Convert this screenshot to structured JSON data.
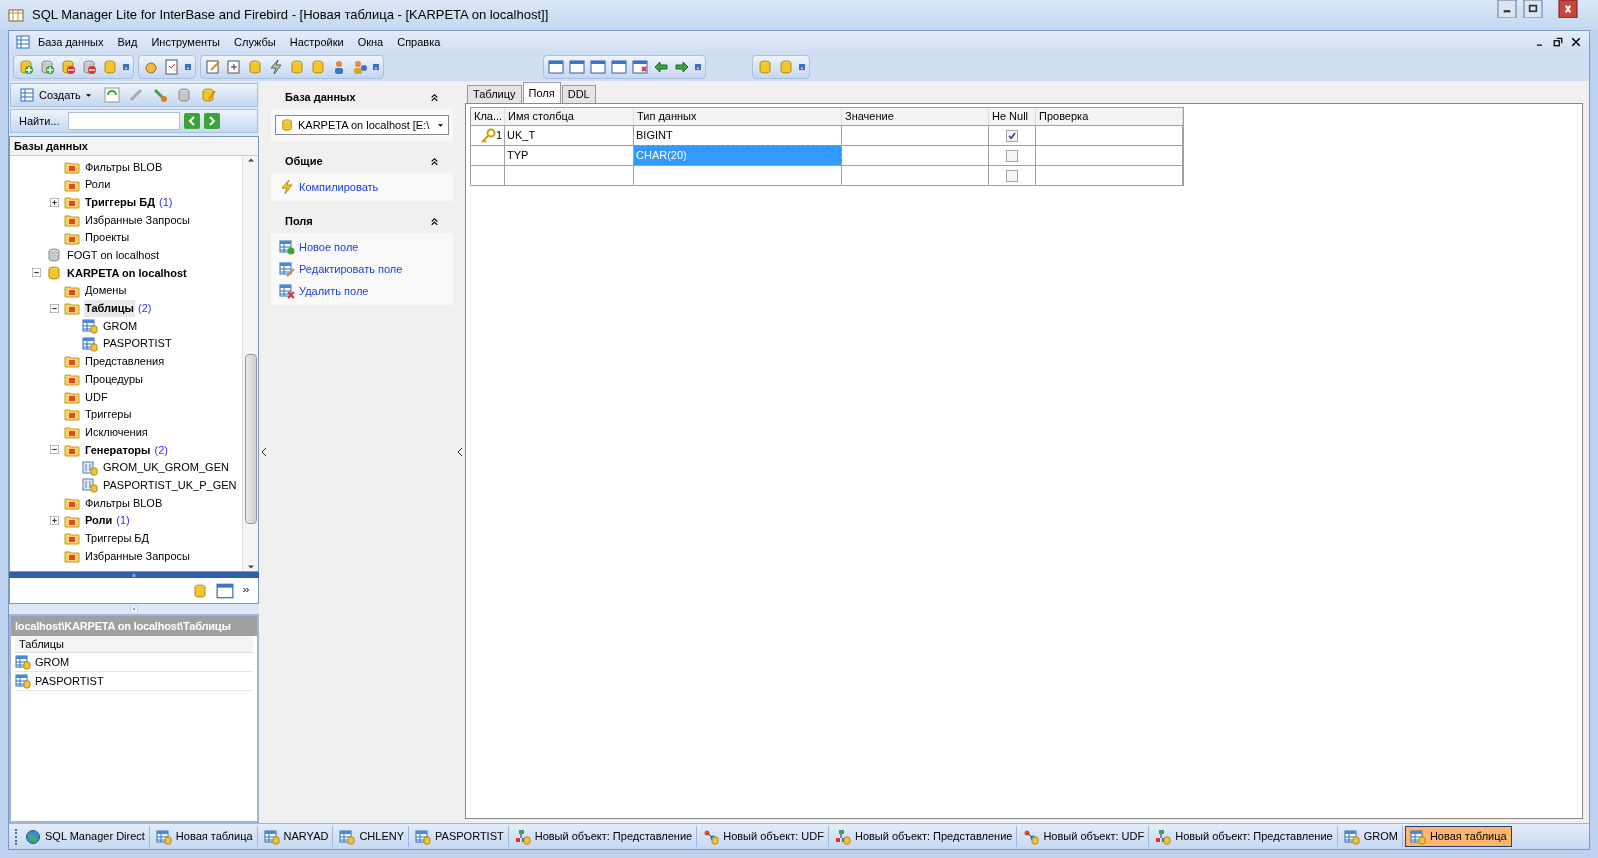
{
  "window": {
    "title": "SQL Manager Lite for InterBase and Firebird - [Новая таблица - [KARPETA on localhost]]"
  },
  "menu": [
    "База данных",
    "Вид",
    "Инструменты",
    "Службы",
    "Настройки",
    "Окна",
    "Справка"
  ],
  "explorer": {
    "create_button": "Создать",
    "search_label": "Найти...",
    "header": "Базы данных",
    "tree": {
      "continued_children": [
        {
          "label": "Фильтры BLOB",
          "kind": "folder",
          "selected": false
        },
        {
          "label": "Роли",
          "kind": "folder",
          "selected": false
        },
        {
          "label": "Триггеры БД",
          "count": "(1)",
          "kind": "folder",
          "expanded": false,
          "selected": false
        },
        {
          "label": "Избранные Запросы",
          "kind": "folder",
          "selected": false
        },
        {
          "label": "Проекты",
          "kind": "folder",
          "selected": false
        }
      ],
      "items": [
        {
          "label": "FOGT on localhost",
          "kind": "database",
          "connected": false,
          "selected": false
        },
        {
          "label": "KARPETA on localhost",
          "kind": "database",
          "connected": true,
          "expanded": true,
          "selected": false,
          "children": [
            {
              "label": "Домены",
              "kind": "folder",
              "selected": false
            },
            {
              "label": "Таблицы",
              "count": "(2)",
              "kind": "folder",
              "expanded": true,
              "selected": true,
              "children": [
                {
                  "label": "GROM",
                  "kind": "table",
                  "selected": false
                },
                {
                  "label": "PASPORTIST",
                  "kind": "table",
                  "selected": false
                }
              ]
            },
            {
              "label": "Представления",
              "kind": "folder",
              "selected": false
            },
            {
              "label": "Процедуры",
              "kind": "folder",
              "selected": false
            },
            {
              "label": "UDF",
              "kind": "folder",
              "selected": false
            },
            {
              "label": "Триггеры",
              "kind": "folder",
              "selected": false
            },
            {
              "label": "Исключения",
              "kind": "folder",
              "selected": false
            },
            {
              "label": "Генераторы",
              "count": "(2)",
              "kind": "folder",
              "expanded": true,
              "selected": false,
              "children": [
                {
                  "label": "GROM_UK_GROM_GEN",
                  "kind": "generator",
                  "selected": false
                },
                {
                  "label": "PASPORTIST_UK_P_GEN",
                  "kind": "generator",
                  "selected": false
                }
              ]
            },
            {
              "label": "Фильтры BLOB",
              "kind": "folder",
              "selected": false
            },
            {
              "label": "Роли",
              "count": "(1)",
              "kind": "folder",
              "expanded": false,
              "selected": false
            },
            {
              "label": "Триггеры БД",
              "kind": "folder",
              "selected": false
            },
            {
              "label": "Избранные Запросы",
              "kind": "folder",
              "selected": false
            }
          ]
        }
      ]
    }
  },
  "object_list": {
    "path": "localhost\\KARPETA on localhost\\Таблицы",
    "column": "Таблицы",
    "rows": [
      "GROM",
      "PASPORTIST"
    ]
  },
  "tasks": {
    "sections": [
      {
        "title": "База данных",
        "kind": "select",
        "value": "KARPETA on localhost [E:\\"
      },
      {
        "title": "Общие",
        "kind": "links",
        "links": [
          "Компилировать"
        ]
      },
      {
        "title": "Поля",
        "kind": "links",
        "links": [
          "Новое поле",
          "Редактировать поле",
          "Удалить поле"
        ]
      }
    ]
  },
  "tabs": [
    {
      "label": "Таблицу",
      "selected": false
    },
    {
      "label": "Поля",
      "selected": true
    },
    {
      "label": "DDL",
      "selected": false
    }
  ],
  "grid": {
    "columns": [
      "Кла...",
      "Имя столбца",
      "Тип данных",
      "Значение",
      "Не Null",
      "Проверка"
    ],
    "rows": [
      {
        "cells": [
          {
            "kind": "key",
            "text": "1",
            "selected": false
          },
          {
            "kind": "text",
            "text": "UK_T",
            "selected": false
          },
          {
            "kind": "text",
            "text": "BIGINT",
            "selected": false
          },
          {
            "kind": "text",
            "selected": false
          },
          {
            "kind": "checkbox",
            "checked": true,
            "selected": false
          },
          {
            "kind": "text",
            "selected": false
          }
        ]
      },
      {
        "cells": [
          {
            "kind": "key",
            "selected": false
          },
          {
            "kind": "text",
            "text": "TYP",
            "selected": false
          },
          {
            "kind": "text",
            "text": "CHAR(20)",
            "selected": true
          },
          {
            "kind": "text",
            "selected": false
          },
          {
            "kind": "checkbox",
            "checked": false,
            "selected": false
          },
          {
            "kind": "text",
            "selected": false
          }
        ]
      },
      {
        "cells": [
          {
            "kind": "key",
            "selected": false
          },
          {
            "kind": "text",
            "selected": false
          },
          {
            "kind": "text",
            "selected": false
          },
          {
            "kind": "text",
            "selected": false
          },
          {
            "kind": "checkbox",
            "checked": false,
            "selected": false
          },
          {
            "kind": "text",
            "selected": false
          }
        ]
      }
    ]
  },
  "taskbar": [
    {
      "label": "SQL Manager Direct",
      "kind": "globe",
      "selected": false
    },
    {
      "label": "Новая таблица",
      "kind": "table",
      "selected": false
    },
    {
      "label": "NARYAD",
      "kind": "table",
      "selected": false
    },
    {
      "label": "CHLENY",
      "kind": "table",
      "selected": false
    },
    {
      "label": "PASPORTIST",
      "kind": "table",
      "selected": false
    },
    {
      "label": "Новый объект: Представление",
      "kind": "view",
      "selected": false
    },
    {
      "label": "Новый объект: UDF",
      "kind": "udf",
      "selected": false
    },
    {
      "label": "Новый объект: Представление",
      "kind": "view",
      "selected": false
    },
    {
      "label": "Новый объект: UDF",
      "kind": "udf",
      "selected": false
    },
    {
      "label": "Новый объект: Представление",
      "kind": "view",
      "selected": false
    },
    {
      "label": "GROM",
      "kind": "table",
      "selected": false
    },
    {
      "label": "Новая таблица",
      "kind": "table",
      "selected": true
    }
  ]
}
